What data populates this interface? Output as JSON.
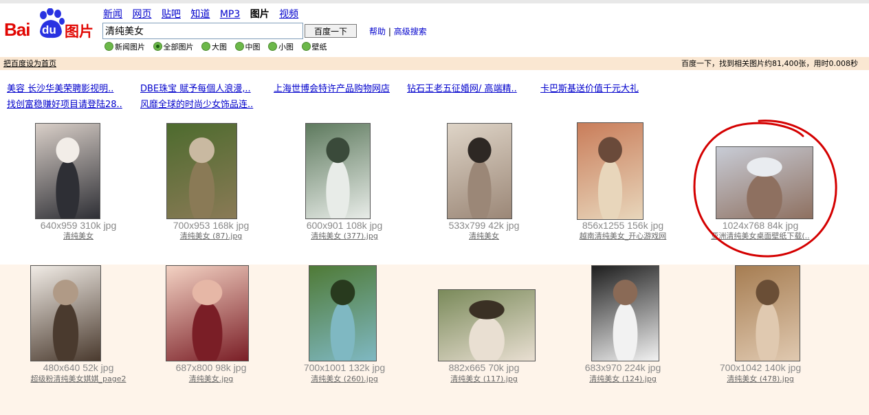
{
  "logo": {
    "bai": "Bai",
    "du": "du",
    "tupian": "图片"
  },
  "nav": [
    "新闻",
    "网页",
    "贴吧",
    "知道",
    "MP3",
    "图片",
    "视频"
  ],
  "search": {
    "value": "清纯美女",
    "button": "百度一下"
  },
  "help": {
    "help": "帮助",
    "sep": "|",
    "advanced": "高级搜索"
  },
  "filters": [
    "新闻图片",
    "全部图片",
    "大图",
    "中图",
    "小图",
    "壁纸"
  ],
  "filter_selected": "全部图片",
  "infobar": {
    "left": "把百度设为首页",
    "right": "百度一下，找到相关图片约81,400张，用时0.008秒"
  },
  "ads": [
    "美容 长沙华美荣聘影视明..",
    "DBE珠宝 赋予每個人浪漫,..",
    "上海世博会特许产品购物网店",
    "钻石王老五征婚网/ 高端精..",
    "卡巴斯基送价值千元大礼",
    "找创富稳赚好项目请登陆28..",
    "风靡全球的时尚少女饰品连.."
  ],
  "images": [
    {
      "size": "640x959 310k jpg",
      "caption": "清纯美女",
      "colors": [
        "#d9cfc8",
        "#2e2f35",
        "#f2ede8"
      ]
    },
    {
      "size": "700x953 168k jpg",
      "caption": "清纯美女 (87).jpg",
      "colors": [
        "#4d6b2e",
        "#8a7a56",
        "#c9b9a1"
      ]
    },
    {
      "size": "600x901 108k jpg",
      "caption": "清纯美女 (377).jpg",
      "colors": [
        "#5e7a5e",
        "#e8ece8",
        "#3a4a3a"
      ]
    },
    {
      "size": "533x799 42k jpg",
      "caption": "清纯美女",
      "colors": [
        "#ded4c7",
        "#9b8777",
        "#2e2824"
      ]
    },
    {
      "size": "856x1255 156k jpg",
      "caption": "越南清纯美女_开心游戏网",
      "colors": [
        "#c97d5a",
        "#e8d6bb",
        "#6a4a3a"
      ]
    },
    {
      "size": "1024x768 84k jpg",
      "caption": "亚洲清纯美女桌面壁纸下载(..",
      "colors": [
        "#c8ccd6",
        "#8e7060",
        "#e9ecf0"
      ]
    },
    {
      "size": "480x640 52k jpg",
      "caption": "超级粉清纯美女娸娸_page2",
      "colors": [
        "#f1ece6",
        "#4a3a2e",
        "#b09a86"
      ]
    },
    {
      "size": "687x800 98k jpg",
      "caption": "清纯美女.jpg",
      "colors": [
        "#f3d2c3",
        "#7a1e26",
        "#e6b7a6"
      ]
    },
    {
      "size": "700x1001 132k jpg",
      "caption": "清纯美女 (260).jpg",
      "colors": [
        "#4f7a36",
        "#7fb8c2",
        "#283a1e"
      ]
    },
    {
      "size": "882x665 70k jpg",
      "caption": "清纯美女 (117).jpg",
      "colors": [
        "#7a8a5a",
        "#e9dfd2",
        "#3a3024"
      ]
    },
    {
      "size": "683x970 224k jpg",
      "caption": "清纯美女 (124).jpg",
      "colors": [
        "#1e1e1e",
        "#f2f2f2",
        "#8a6a56"
      ]
    },
    {
      "size": "700x1042 140k jpg",
      "caption": "清纯美女 (478).jpg",
      "colors": [
        "#a67d52",
        "#e0c9b0",
        "#6a4e36"
      ]
    }
  ],
  "highlight_color": "#d40000",
  "filter_color": "#6cb84a",
  "infobar_bg": "#fae7d2"
}
